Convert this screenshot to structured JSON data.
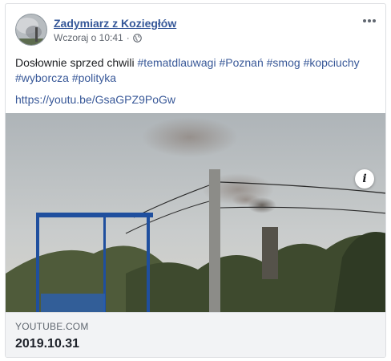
{
  "post": {
    "author": "Zadymiarz z Koziegłów",
    "timestamp": "Wczoraj o 10:41",
    "separator": "·",
    "privacy_icon": "globe-icon",
    "menu_icon": "more-options-icon",
    "text_prefix": "Dosłownie sprzed chwili",
    "hashtags": [
      "#tematdlauwagi",
      "#Poznań",
      "#smog",
      "#kopciuchy",
      "#wyborcza",
      "#polityka"
    ],
    "link": "https://youtu.be/GsaGPZ9PoGw"
  },
  "preview": {
    "image_description": "smoke-from-chimney-photo",
    "info_icon_label": "i",
    "domain": "YOUTUBE.COM",
    "title": "2019.10.31"
  },
  "colors": {
    "link": "#385898",
    "author": "#365899",
    "footer_bg": "#f2f3f5"
  }
}
